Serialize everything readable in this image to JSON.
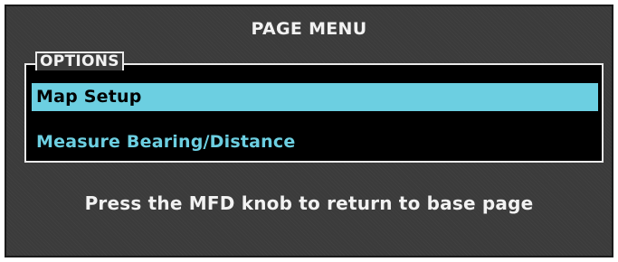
{
  "header": {
    "title": "PAGE MENU"
  },
  "options": {
    "label": "OPTIONS",
    "items": [
      {
        "label": "Map Setup",
        "selected": true
      },
      {
        "label": "Measure Bearing/Distance",
        "selected": false
      }
    ]
  },
  "footer": {
    "message": "Press the MFD knob to return to base page"
  },
  "colors": {
    "panel_background": "#3b3b3b",
    "list_background": "#000000",
    "highlight": "#6ccfe1",
    "text": "#f2f2f2"
  }
}
